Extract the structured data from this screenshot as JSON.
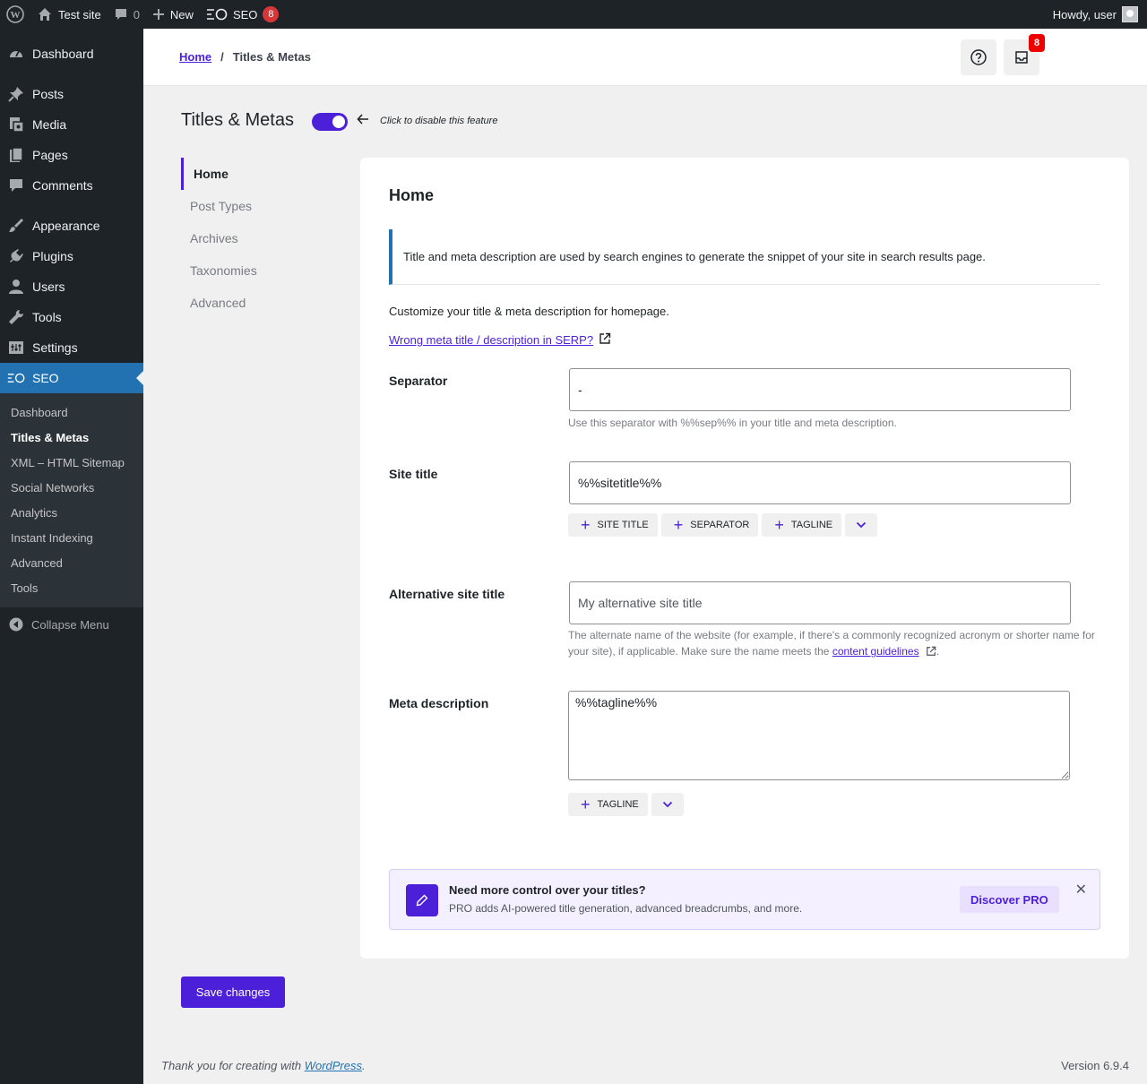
{
  "adminbar": {
    "site_name": "Test site",
    "comments_count": "0",
    "new_label": "New",
    "seo_label": "SEO",
    "seo_badge": "8",
    "howdy": "Howdy, user"
  },
  "sidebar": {
    "items": [
      {
        "label": "Dashboard",
        "icon": "dashboard-icon"
      },
      {
        "label": "Posts",
        "icon": "pin-icon"
      },
      {
        "label": "Media",
        "icon": "media-icon"
      },
      {
        "label": "Pages",
        "icon": "pages-icon"
      },
      {
        "label": "Comments",
        "icon": "comment-icon"
      },
      {
        "label": "Appearance",
        "icon": "brush-icon"
      },
      {
        "label": "Plugins",
        "icon": "plug-icon"
      },
      {
        "label": "Users",
        "icon": "user-icon"
      },
      {
        "label": "Tools",
        "icon": "wrench-icon"
      },
      {
        "label": "Settings",
        "icon": "sliders-icon"
      },
      {
        "label": "SEO",
        "icon": "seo-icon"
      }
    ],
    "submenu": [
      "Dashboard",
      "Titles & Metas",
      "XML – HTML Sitemap",
      "Social Networks",
      "Analytics",
      "Instant Indexing",
      "Advanced",
      "Tools"
    ],
    "collapse": "Collapse Menu"
  },
  "header": {
    "breadcrumb_home": "Home",
    "breadcrumb_sep": "/",
    "breadcrumb_current": "Titles & Metas",
    "notif_badge": "8"
  },
  "page": {
    "title": "Titles & Metas",
    "toggle_hint": "Click to disable this feature",
    "toggle_on": true
  },
  "subnav": [
    "Home",
    "Post Types",
    "Archives",
    "Taxonomies",
    "Advanced"
  ],
  "card": {
    "title": "Home",
    "notice": "Title and meta description are used by search engines to generate the snippet of your site in search results page.",
    "intro": "Customize your title & meta description for homepage.",
    "serp_link": "Wrong meta title / description in SERP?",
    "separator": {
      "label": "Separator",
      "value": "-",
      "help": "Use this separator with %%sep%% in your title and meta description."
    },
    "site_title": {
      "label": "Site title",
      "value": "%%sitetitle%%",
      "tags": [
        "SITE TITLE",
        "SEPARATOR",
        "TAGLINE"
      ]
    },
    "alt_title": {
      "label": "Alternative site title",
      "placeholder": "My alternative site title",
      "help_before": "The alternate name of the website (for example, if there's a commonly recognized acronym or shorter name for your site), if applicable. Make sure the name meets the",
      "help_link": "content guidelines",
      "help_after": "."
    },
    "meta_desc": {
      "label": "Meta description",
      "value": "%%tagline%%",
      "tags": [
        "TAGLINE"
      ]
    },
    "promo": {
      "title": "Need more control over your titles?",
      "text": "PRO adds AI-powered title generation, advanced breadcrumbs, and more.",
      "button": "Discover PRO",
      "close": "✕"
    }
  },
  "save_label": "Save changes",
  "footer": {
    "thanks_before": "Thank you for creating with",
    "thanks_link": "WordPress",
    "thanks_after": ".",
    "version": "Version 6.9.4"
  },
  "colors": {
    "accent": "#4c1fd8",
    "wp_blue": "#2271b1",
    "admin_dark": "#1d2327",
    "badge_red": "#d63638"
  }
}
